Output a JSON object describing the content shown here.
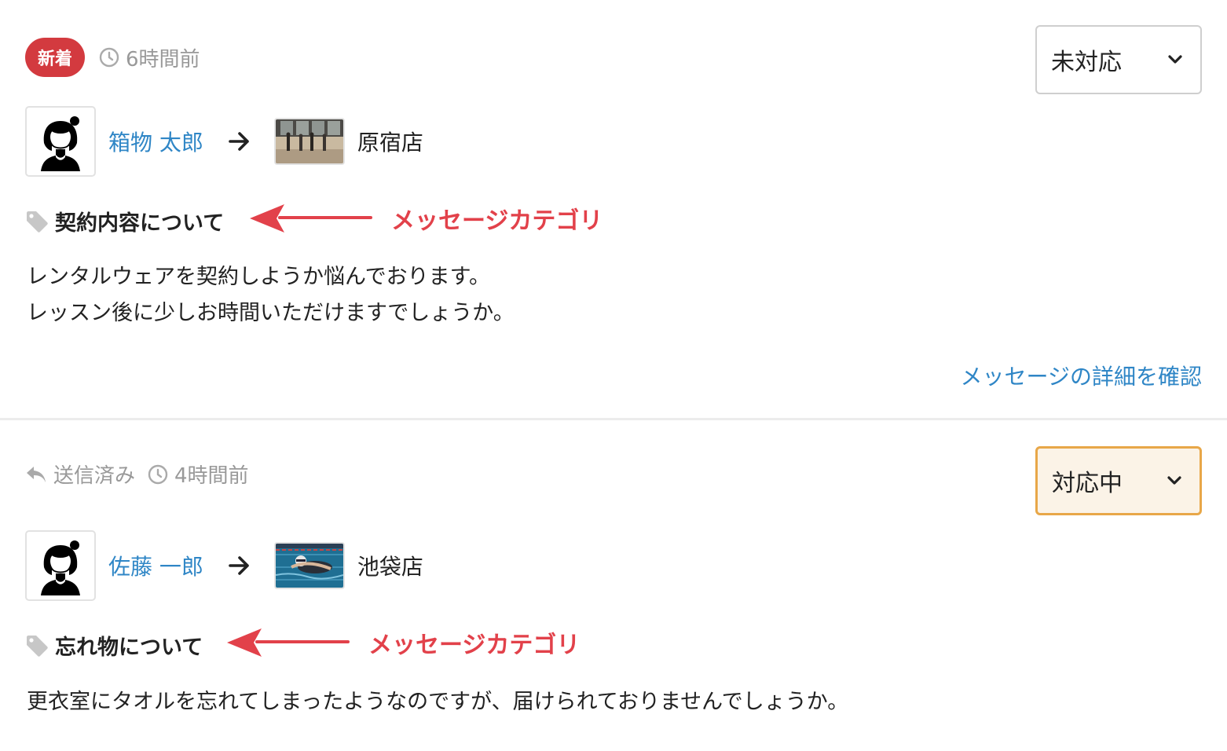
{
  "messages": [
    {
      "badge": "新着",
      "time": "6時間前",
      "status": "未対応",
      "user": "箱物 太郎",
      "store": "原宿店",
      "category": "契約内容について",
      "body_lines": [
        "レンタルウェアを契約しようか悩んでおります。",
        "レッスン後に少しお時間いただけますでしょうか。"
      ],
      "detail_link": "メッセージの詳細を確認"
    },
    {
      "sent": "送信済み",
      "time": "4時間前",
      "status": "対応中",
      "user": "佐藤 一郎",
      "store": "池袋店",
      "category": "忘れ物について",
      "body_lines": [
        "更衣室にタオルを忘れてしまったようなのですが、届けられておりませんでしょうか。"
      ]
    }
  ],
  "annotation_label": "メッセージカテゴリ",
  "colors": {
    "new_badge": "#d33a3f",
    "link": "#2f86c6",
    "annotation": "#e2414a",
    "in_progress_border": "#e8a748",
    "in_progress_bg": "#fbf3e7"
  },
  "icons": [
    "clock-icon",
    "reply-icon",
    "tag-icon",
    "arrow-right-icon",
    "chevron-down-icon",
    "user-avatar-icon"
  ]
}
